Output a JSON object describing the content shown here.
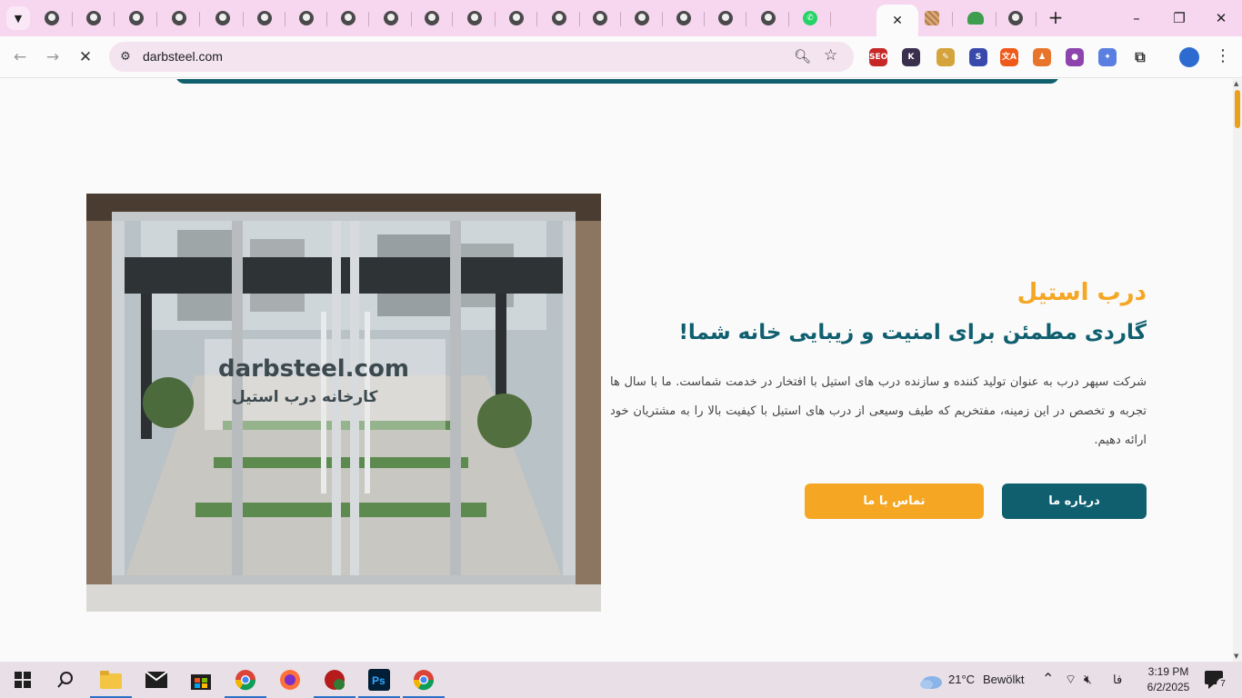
{
  "browser": {
    "tabs_count": 22,
    "active_tab_close": "✕",
    "new_tab": "+",
    "window_controls": {
      "minimize": "–",
      "restore": "❐",
      "close": "✕"
    },
    "url": "darbsteel.com",
    "extensions": [
      {
        "name": "seo-extension",
        "label": "SEO",
        "color": "#c62828"
      },
      {
        "name": "k-extension",
        "label": "K",
        "color": "#3a2f4d"
      },
      {
        "name": "pen-extension",
        "label": "✎",
        "color": "#d4a33b"
      },
      {
        "name": "s-extension",
        "label": "S",
        "color": "#3949ab"
      },
      {
        "name": "translate-extension",
        "label": "文A",
        "color": "#ef5a1a"
      },
      {
        "name": "chess-extension",
        "label": "♟",
        "color": "#e8742b"
      },
      {
        "name": "color-extension",
        "label": "●",
        "color": "#8e44ad"
      },
      {
        "name": "magic-extension",
        "label": "✦",
        "color": "#5b7fe0"
      }
    ]
  },
  "page": {
    "hero": {
      "title": "درب استیل",
      "subtitle": "گاردی مطمئن برای امنیت و زیبایی خانه شما!",
      "description": "شرکت سپهر درب به عنوان تولید کننده و سازنده درب های استیل با افتخار در خدمت شماست. ما با سال ها تجربه و تخصص در این زمینه، مفتخریم که طیف وسیعی از درب های استیل با کیفیت بالا را به مشتریان خود ارائه دهیم.",
      "image_watermark_line1": "darbsteel.com",
      "image_watermark_line2": "کارخانه درب استیل",
      "buttons": {
        "about": "درباره ما",
        "contact": "تماس با ما"
      }
    },
    "colors": {
      "primary": "#0f5f6f",
      "accent": "#f5a623"
    }
  },
  "taskbar": {
    "weather_temp": "21°C",
    "weather_text": "Bewölkt",
    "language": "فا",
    "time": "3:19 PM",
    "date": "6/2/2025",
    "notifications_count": "7"
  }
}
